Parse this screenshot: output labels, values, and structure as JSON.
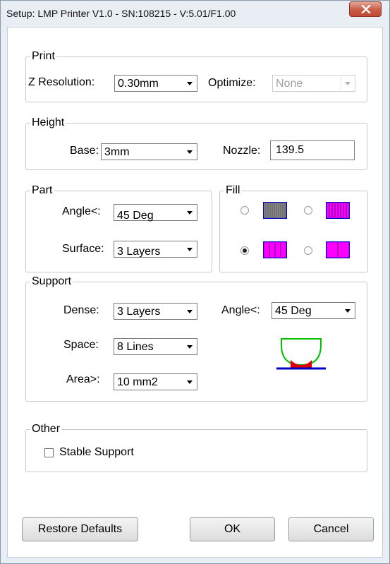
{
  "window": {
    "title": "Setup: LMP Printer V1.0 - SN:108215 - V:5.01/F1.00",
    "close_icon": "close-icon"
  },
  "print": {
    "legend": "Print",
    "z_resolution_label": "Z Resolution:",
    "z_resolution_value": "0.30mm",
    "optimize_label": "Optimize:",
    "optimize_value": "None"
  },
  "height": {
    "legend": "Height",
    "base_label": "Base:",
    "base_value": "3mm",
    "nozzle_label": "Nozzle:",
    "nozzle_value": "139.5"
  },
  "part": {
    "legend": "Part",
    "angle_label": "Angle<:",
    "angle_value": "45 Deg",
    "surface_label": "Surface:",
    "surface_value": "3 Layers"
  },
  "fill": {
    "legend": "Fill",
    "options": [
      {
        "icon": "fill-dense-gray-icon",
        "color": "#808080",
        "checked": false
      },
      {
        "icon": "fill-fine-magenta-icon",
        "color": "#ff00ff",
        "checked": false
      },
      {
        "icon": "fill-medium-magenta-icon",
        "color": "#ff00ff",
        "checked": true
      },
      {
        "icon": "fill-sparse-magenta-icon",
        "color": "#ff00ff",
        "checked": false
      }
    ]
  },
  "support": {
    "legend": "Support",
    "dense_label": "Dense:",
    "dense_value": "3 Layers",
    "space_label": "Space:",
    "space_value": "8 Lines",
    "area_label": "Area>:",
    "area_value": "10 mm2",
    "angle_label": "Angle<:",
    "angle_value": "45 Deg",
    "preview_icon": "support-angle-preview-icon"
  },
  "other": {
    "legend": "Other",
    "stable_support_label": "Stable Support",
    "stable_support_checked": false
  },
  "buttons": {
    "restore_defaults": "Restore Defaults",
    "ok": "OK",
    "cancel": "Cancel"
  },
  "colors": {
    "fill_magenta": "#ff00ff",
    "fill_border": "#0000c0",
    "support_green": "#00c000",
    "support_red": "#e00000",
    "base_blue": "#0000c0"
  }
}
